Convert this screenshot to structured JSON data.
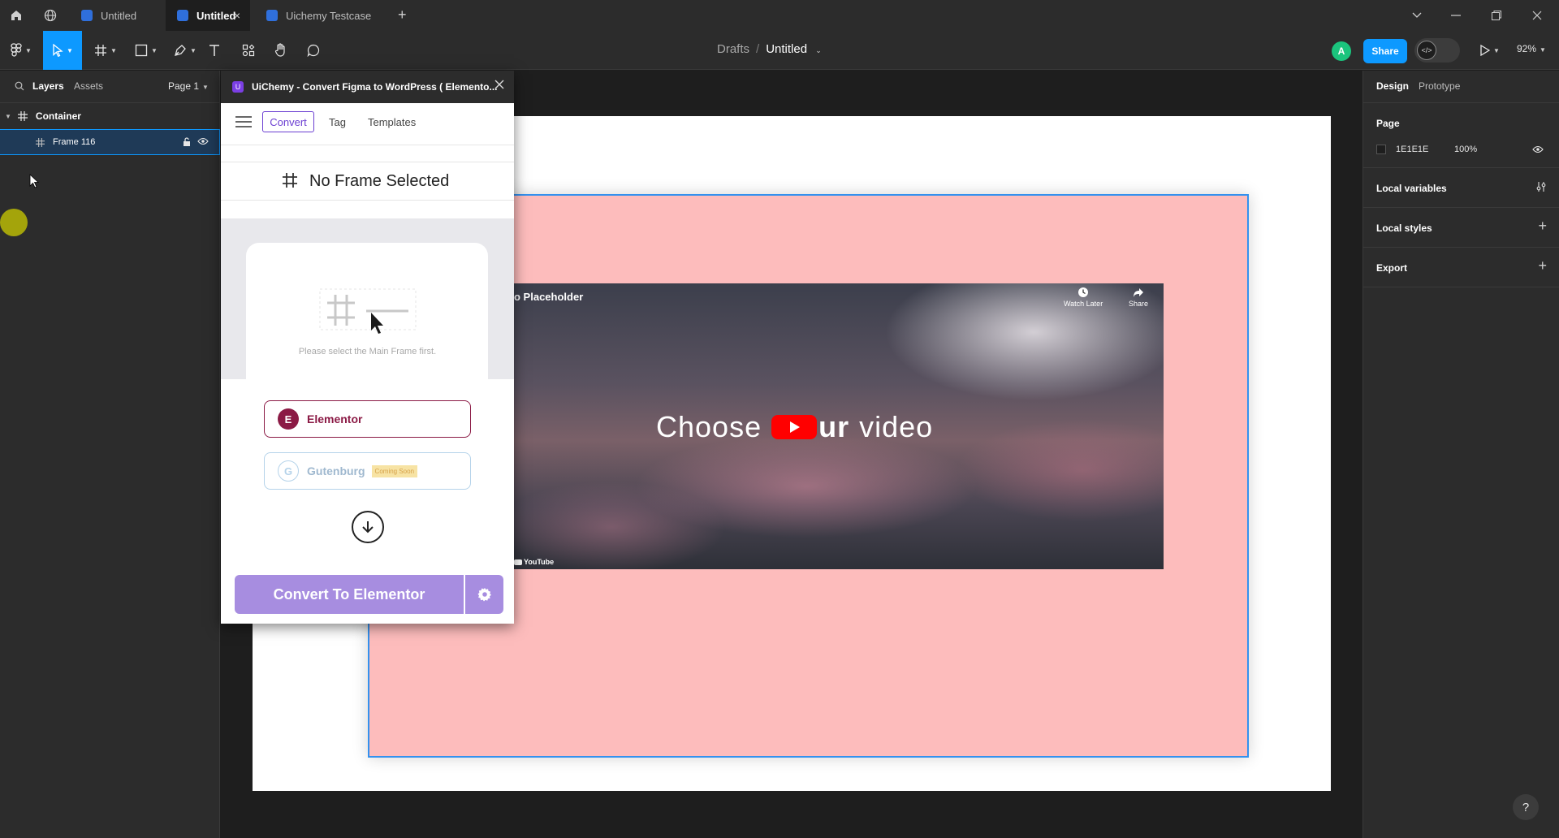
{
  "titlebar": {
    "tabs": [
      {
        "label": "Untitled",
        "active": false
      },
      {
        "label": "Untitled",
        "active": true
      },
      {
        "label": "Uichemy Testcase",
        "active": false
      }
    ],
    "new_tab": "+",
    "close_tab": "×"
  },
  "toolbar": {
    "breadcrumb_folder": "Drafts",
    "breadcrumb_sep": "/",
    "file_name": "Untitled",
    "avatar_initial": "A",
    "share_label": "Share",
    "zoom": "92%"
  },
  "left_panel": {
    "tabs": [
      "Layers",
      "Assets"
    ],
    "page_selector": "Page 1",
    "layers": [
      {
        "name": "Container",
        "level": 0
      },
      {
        "name": "Frame 116",
        "level": 1,
        "selected": true
      }
    ]
  },
  "plugin": {
    "title": "UiChemy - Convert Figma to WordPress ( Elemento...",
    "nav": {
      "convert": "Convert",
      "tag": "Tag",
      "templates": "Templates"
    },
    "status_text": "No Frame Selected",
    "placeholder_text": "Please select the Main Frame first.",
    "builders": [
      {
        "label": "Elementor",
        "icon": "E",
        "badge": ""
      },
      {
        "label": "Gutenburg",
        "icon": "G",
        "badge": "Coming Soon"
      }
    ],
    "convert_button": "Convert To Elementor"
  },
  "canvas": {
    "video": {
      "title": "o Placeholder",
      "watch_later": "Watch Later",
      "share": "Share",
      "headline_left": "Choose",
      "headline_mid": "ur",
      "headline_right": "video",
      "brand": "YouTube"
    }
  },
  "right_panel": {
    "tabs": [
      "Design",
      "Prototype"
    ],
    "page_label": "Page",
    "page_color_hex": "1E1E1E",
    "page_opacity": "100%",
    "sections": [
      "Local variables",
      "Local styles",
      "Export"
    ]
  },
  "help": "?",
  "colors": {
    "accent": "#0d99ff",
    "plugin_purple": "#a78de0",
    "elementor": "#8b1a45",
    "frame_pink": "#fdbcbc",
    "avatar_green": "#1bc47d"
  }
}
